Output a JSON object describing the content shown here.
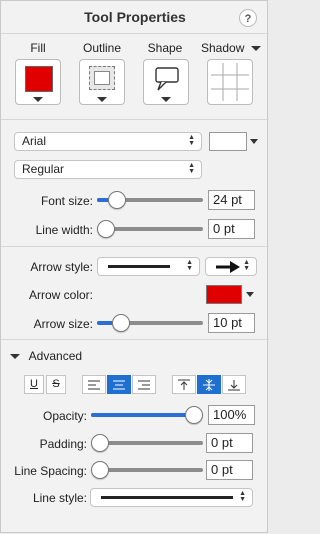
{
  "header": {
    "title": "Tool Properties",
    "help_label": "?"
  },
  "tabs": [
    {
      "label": "Fill"
    },
    {
      "label": "Outline"
    },
    {
      "label": "Shape"
    },
    {
      "label": "Shadow"
    }
  ],
  "colors": {
    "fill_swatch": "#e00000",
    "arrow_color": "#e00000",
    "accent": "#1f6fd0"
  },
  "font": {
    "family": "Arial",
    "style": "Regular",
    "size_label": "Font size:",
    "size_value": "24 pt",
    "size_level": 0.12,
    "width_label": "Line width:",
    "width_value": "0 pt",
    "width_level": 0.0
  },
  "arrow": {
    "style_label": "Arrow style:",
    "color_label": "Arrow color:",
    "size_label": "Arrow size:",
    "size_value": "10 pt",
    "size_level": 0.17
  },
  "advanced": {
    "label": "Advanced",
    "underline_label": "U",
    "strike_label": "S",
    "opacity_label": "Opacity:",
    "opacity_value": "100%",
    "opacity_level": 1.0,
    "padding_label": "Padding:",
    "padding_value": "0 pt",
    "padding_level": 0.0,
    "spacing_label": "Line Spacing:",
    "spacing_value": "0 pt",
    "spacing_level": 0.0,
    "linestyle_label": "Line style:"
  }
}
